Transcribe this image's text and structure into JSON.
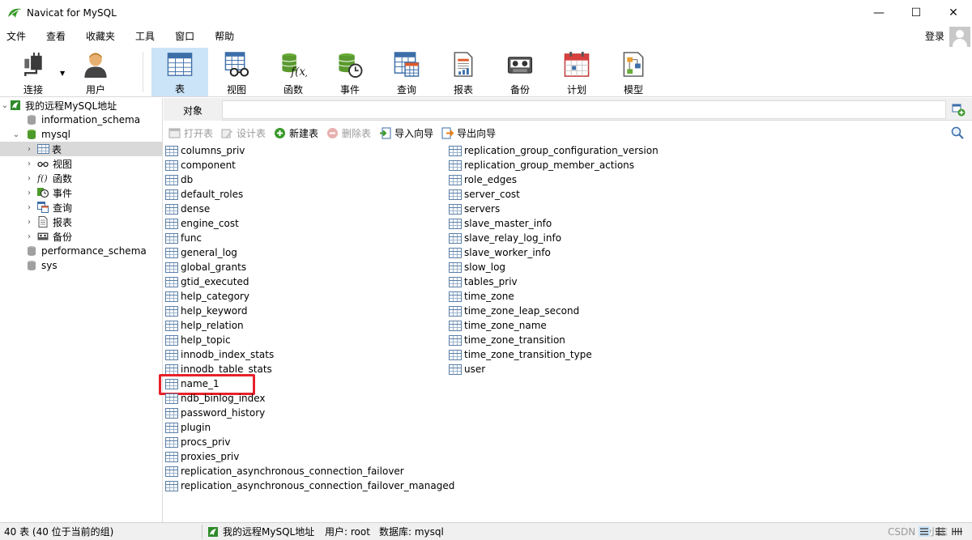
{
  "window": {
    "title": "Navicat for MySQL",
    "minimize": "—",
    "maximize": "☐",
    "close": "✕"
  },
  "menu": [
    "文件",
    "查看",
    "收藏夹",
    "工具",
    "窗口",
    "帮助"
  ],
  "login_label": "登录",
  "toolbar": [
    {
      "label": "连接",
      "icon": "plug-icon"
    },
    {
      "label": "用户",
      "icon": "user-icon"
    },
    {
      "label": "表",
      "icon": "table-icon",
      "active": true
    },
    {
      "label": "视图",
      "icon": "view-icon"
    },
    {
      "label": "函数",
      "icon": "function-icon"
    },
    {
      "label": "事件",
      "icon": "event-icon"
    },
    {
      "label": "查询",
      "icon": "query-icon"
    },
    {
      "label": "报表",
      "icon": "report-icon"
    },
    {
      "label": "备份",
      "icon": "backup-icon"
    },
    {
      "label": "计划",
      "icon": "schedule-icon"
    },
    {
      "label": "模型",
      "icon": "model-icon"
    }
  ],
  "tree": {
    "connection": "我的远程MySQL地址",
    "databases": [
      "information_schema",
      "mysql",
      "performance_schema",
      "sys"
    ],
    "mysql_children": [
      "表",
      "视图",
      "函数",
      "事件",
      "查询",
      "报表",
      "备份"
    ]
  },
  "tab": {
    "label": "对象"
  },
  "object_toolbar": [
    {
      "label": "打开表",
      "enabled": false
    },
    {
      "label": "设计表",
      "enabled": false
    },
    {
      "label": "新建表",
      "enabled": true
    },
    {
      "label": "删除表",
      "enabled": false
    },
    {
      "label": "导入向导",
      "enabled": true
    },
    {
      "label": "导出向导",
      "enabled": true
    }
  ],
  "tables_col1": [
    "columns_priv",
    "component",
    "db",
    "default_roles",
    "dense",
    "engine_cost",
    "func",
    "general_log",
    "global_grants",
    "gtid_executed",
    "help_category",
    "help_keyword",
    "help_relation",
    "help_topic",
    "innodb_index_stats",
    "innodb_table_stats",
    "name_1",
    "ndb_binlog_index",
    "password_history",
    "plugin",
    "procs_priv",
    "proxies_priv",
    "replication_asynchronous_connection_failover",
    "replication_asynchronous_connection_failover_managed"
  ],
  "tables_col2": [
    "replication_group_configuration_version",
    "replication_group_member_actions",
    "role_edges",
    "server_cost",
    "servers",
    "slave_master_info",
    "slave_relay_log_info",
    "slave_worker_info",
    "slow_log",
    "tables_priv",
    "time_zone",
    "time_zone_leap_second",
    "time_zone_name",
    "time_zone_transition",
    "time_zone_transition_type",
    "user"
  ],
  "highlighted_table": "name_1",
  "status": {
    "count": "40 表 (40 位于当前的组)",
    "connection": "我的远程MySQL地址",
    "user": "用户: root",
    "database": "数据库: mysql",
    "watermark": "CSDN @小志"
  }
}
